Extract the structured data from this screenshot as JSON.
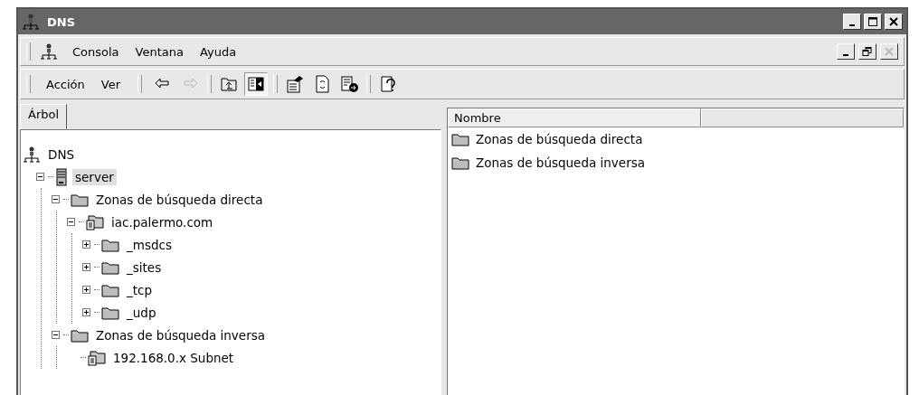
{
  "window": {
    "title": "DNS",
    "controls": [
      {
        "kind": "minimize",
        "disabled": false
      },
      {
        "kind": "maximize",
        "disabled": false
      },
      {
        "kind": "close",
        "disabled": false
      }
    ]
  },
  "menu_bar": {
    "items": [
      "Consola",
      "Ventana",
      "Ayuda"
    ],
    "mdi_controls": [
      {
        "kind": "minimize",
        "disabled": false
      },
      {
        "kind": "restore",
        "disabled": false
      },
      {
        "kind": "close",
        "disabled": true
      }
    ]
  },
  "toolbar": {
    "menus": [
      "Acción",
      "Ver"
    ],
    "buttons": [
      {
        "kind": "back",
        "disabled": false,
        "pressed": false
      },
      {
        "kind": "forward",
        "disabled": true,
        "pressed": false
      },
      {
        "kind": "up",
        "disabled": false,
        "pressed": false
      },
      {
        "kind": "tree",
        "disabled": false,
        "pressed": true
      },
      {
        "kind": "properties",
        "disabled": false,
        "pressed": false
      },
      {
        "kind": "refresh",
        "disabled": false,
        "pressed": false
      },
      {
        "kind": "export",
        "disabled": false,
        "pressed": false
      },
      {
        "kind": "help",
        "disabled": false,
        "pressed": false
      }
    ]
  },
  "tree_pane": {
    "tab": "Árbol",
    "tree": [
      {
        "label": "DNS",
        "kind": "root",
        "selected": false,
        "children": [
          {
            "label": "server",
            "kind": "server",
            "selected": true,
            "expanded": true,
            "children": [
              {
                "label": "Zonas de búsqueda directa",
                "kind": "folder",
                "selected": false,
                "expanded": true,
                "children": [
                  {
                    "label": "iac.palermo.com",
                    "kind": "zone",
                    "selected": false,
                    "expanded": true,
                    "children": [
                      {
                        "label": "_msdcs",
                        "kind": "folder",
                        "selected": false,
                        "expanded": false
                      },
                      {
                        "label": "_sites",
                        "kind": "folder",
                        "selected": false,
                        "expanded": false
                      },
                      {
                        "label": "_tcp",
                        "kind": "folder",
                        "selected": false,
                        "expanded": false
                      },
                      {
                        "label": "_udp",
                        "kind": "folder",
                        "selected": false,
                        "expanded": false
                      }
                    ]
                  }
                ]
              },
              {
                "label": "Zonas de búsqueda inversa",
                "kind": "folder",
                "selected": false,
                "expanded": true,
                "children": [
                  {
                    "label": "192.168.0.x Subnet",
                    "kind": "zone",
                    "selected": false
                  }
                ]
              }
            ]
          }
        ]
      }
    ]
  },
  "list_pane": {
    "columns": [
      "Nombre"
    ],
    "rows": [
      {
        "name": "Zonas de búsqueda directa",
        "kind": "folder"
      },
      {
        "name": "Zonas de búsqueda inversa",
        "kind": "folder"
      }
    ]
  }
}
